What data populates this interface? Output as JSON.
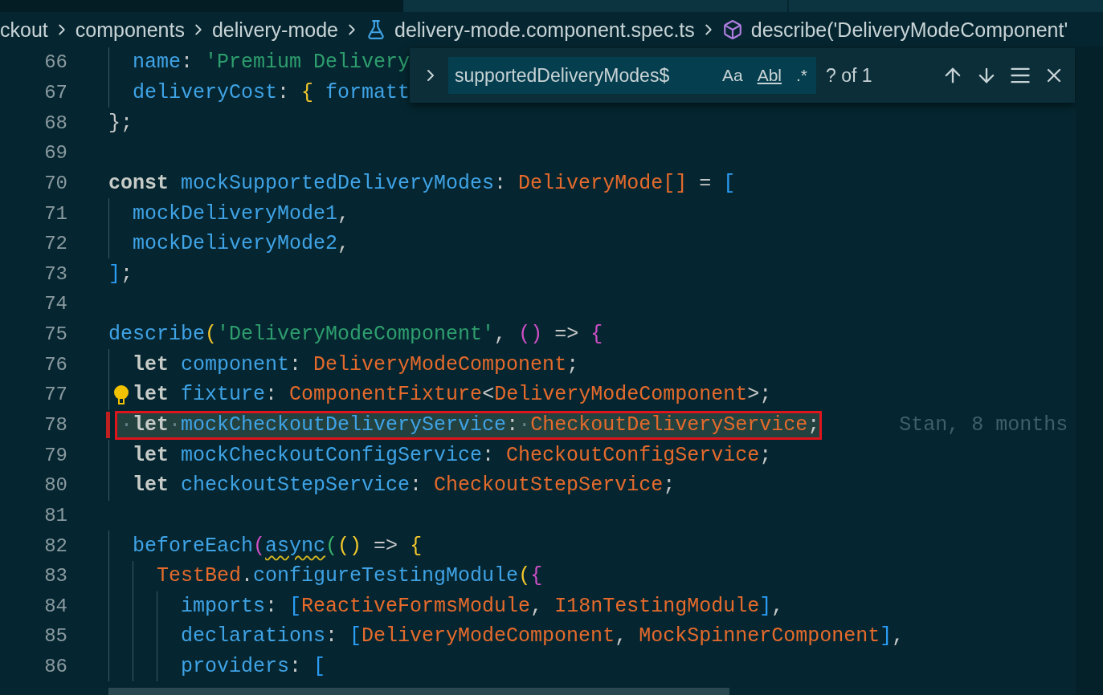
{
  "breadcrumbs": [
    {
      "kind": "folder",
      "label": "ckout"
    },
    {
      "kind": "folder",
      "label": "components"
    },
    {
      "kind": "folder",
      "label": "delivery-mode"
    },
    {
      "kind": "file",
      "label": "delivery-mode.component.spec.ts"
    },
    {
      "kind": "symbol",
      "label": "describe('DeliveryModeComponent'"
    }
  ],
  "find_widget": {
    "query": "supportedDeliveryModes$",
    "options": [
      {
        "label": "Aa",
        "on": false
      },
      {
        "label": "Abl",
        "on": false
      },
      {
        "label": ".*",
        "on": false
      }
    ],
    "result": "? of 1"
  },
  "lines": [
    {
      "number": "66",
      "tokens": [
        {
          "t": "  name",
          "kind": "prop"
        },
        {
          "t": ": ",
          "kind": "punct"
        },
        {
          "t": "'Premium Delivery",
          "kind": "str"
        }
      ]
    },
    {
      "number": "67",
      "tokens": [
        {
          "t": "  deliveryCost",
          "kind": "prop"
        },
        {
          "t": ": ",
          "kind": "punct"
        },
        {
          "t": "{ ",
          "kind": "b1"
        },
        {
          "t": "formatt",
          "kind": "prop"
        }
      ]
    },
    {
      "number": "68",
      "tokens": [
        {
          "t": "};",
          "kind": "punct"
        }
      ]
    },
    {
      "number": "69"
    },
    {
      "number": "70",
      "tokens": [
        {
          "t": "const ",
          "kind": "kw"
        },
        {
          "t": "mockSupportedDeliveryModes",
          "kind": "prop"
        },
        {
          "t": ": ",
          "kind": "punct"
        },
        {
          "t": "DeliveryMode[]",
          "kind": "type"
        },
        {
          "t": " = ",
          "kind": "punct"
        },
        {
          "t": "[",
          "kind": "b3"
        }
      ]
    },
    {
      "number": "71",
      "tokens": [
        {
          "t": "  mockDeliveryMode1",
          "kind": "prop"
        },
        {
          "t": ",",
          "kind": "punct"
        }
      ]
    },
    {
      "number": "72",
      "tokens": [
        {
          "t": "  mockDeliveryMode2",
          "kind": "prop"
        },
        {
          "t": ",",
          "kind": "punct"
        }
      ]
    },
    {
      "number": "73",
      "tokens": [
        {
          "t": "]",
          "kind": "b3"
        },
        {
          "t": ";",
          "kind": "punct"
        }
      ]
    },
    {
      "number": "74"
    },
    {
      "number": "75",
      "tokens": [
        {
          "t": "describe",
          "kind": "prop"
        },
        {
          "t": "(",
          "kind": "b1"
        },
        {
          "t": "'DeliveryModeComponent'",
          "kind": "str"
        },
        {
          "t": ", ",
          "kind": "punct"
        },
        {
          "t": "()",
          "kind": "b2"
        },
        {
          "t": " => ",
          "kind": "punct"
        },
        {
          "t": "{",
          "kind": "b2"
        }
      ]
    },
    {
      "number": "76",
      "tokens": [
        {
          "t": "  let ",
          "kind": "kw"
        },
        {
          "t": "component",
          "kind": "prop"
        },
        {
          "t": ": ",
          "kind": "punct"
        },
        {
          "t": "DeliveryModeComponent",
          "kind": "type"
        },
        {
          "t": ";",
          "kind": "punct"
        }
      ]
    },
    {
      "number": "77",
      "lightbulb": true,
      "tokens": [
        {
          "t": "  let ",
          "kind": "kw"
        },
        {
          "t": "fixture",
          "kind": "prop"
        },
        {
          "t": ": ",
          "kind": "punct"
        },
        {
          "t": "ComponentFixture",
          "kind": "type"
        },
        {
          "t": "<",
          "kind": "punct"
        },
        {
          "t": "DeliveryModeComponent",
          "kind": "type"
        },
        {
          "t": ">;",
          "kind": "punct"
        }
      ]
    },
    {
      "number": "78",
      "modified": true,
      "highlighted": true,
      "blame": "Stan, 8 months",
      "tokens": [
        {
          "t": "·",
          "kind": "dot"
        },
        {
          "t": "let",
          "kind": "kw"
        },
        {
          "t": "·",
          "kind": "dot"
        },
        {
          "t": "mockCheckoutDeliveryService",
          "kind": "prop"
        },
        {
          "t": ":",
          "kind": "punct"
        },
        {
          "t": "·",
          "kind": "dot"
        },
        {
          "t": "CheckoutDeliveryService",
          "kind": "type"
        },
        {
          "t": ";",
          "kind": "punct"
        }
      ]
    },
    {
      "number": "79",
      "tokens": [
        {
          "t": "  let ",
          "kind": "kw"
        },
        {
          "t": "mockCheckoutConfigService",
          "kind": "prop"
        },
        {
          "t": ": ",
          "kind": "punct"
        },
        {
          "t": "CheckoutConfigService",
          "kind": "type"
        },
        {
          "t": ";",
          "kind": "punct"
        }
      ]
    },
    {
      "number": "80",
      "tokens": [
        {
          "t": "  let ",
          "kind": "kw"
        },
        {
          "t": "checkoutStepService",
          "kind": "prop"
        },
        {
          "t": ": ",
          "kind": "punct"
        },
        {
          "t": "CheckoutStepService",
          "kind": "type"
        },
        {
          "t": ";",
          "kind": "punct"
        }
      ]
    },
    {
      "number": "81"
    },
    {
      "number": "82",
      "tokens": [
        {
          "t": "  beforeEach",
          "kind": "prop"
        },
        {
          "t": "(",
          "kind": "b2"
        },
        {
          "t": "async",
          "kind": "warn"
        },
        {
          "t": "(",
          "kind": "b4"
        },
        {
          "t": "()",
          "kind": "b1"
        },
        {
          "t": " => ",
          "kind": "punct"
        },
        {
          "t": "{",
          "kind": "b1"
        }
      ]
    },
    {
      "number": "83",
      "tokens": [
        {
          "t": "    TestBed",
          "kind": "type"
        },
        {
          "t": ".",
          "kind": "punct"
        },
        {
          "t": "configureTestingModule",
          "kind": "prop"
        },
        {
          "t": "(",
          "kind": "b1"
        },
        {
          "t": "{",
          "kind": "b2"
        }
      ]
    },
    {
      "number": "84",
      "tokens": [
        {
          "t": "      imports",
          "kind": "prop"
        },
        {
          "t": ": ",
          "kind": "punct"
        },
        {
          "t": "[",
          "kind": "b3"
        },
        {
          "t": "ReactiveFormsModule",
          "kind": "type"
        },
        {
          "t": ", ",
          "kind": "punct"
        },
        {
          "t": "I18nTestingModule",
          "kind": "type"
        },
        {
          "t": "]",
          "kind": "b3"
        },
        {
          "t": ",",
          "kind": "punct"
        }
      ]
    },
    {
      "number": "85",
      "tokens": [
        {
          "t": "      declarations",
          "kind": "prop"
        },
        {
          "t": ": ",
          "kind": "punct"
        },
        {
          "t": "[",
          "kind": "b3"
        },
        {
          "t": "DeliveryModeComponent",
          "kind": "type"
        },
        {
          "t": ", ",
          "kind": "punct"
        },
        {
          "t": "MockSpinnerComponent",
          "kind": "type"
        },
        {
          "t": "]",
          "kind": "b3"
        },
        {
          "t": ",",
          "kind": "punct"
        }
      ]
    },
    {
      "number": "86",
      "tokens": [
        {
          "t": "      providers",
          "kind": "prop"
        },
        {
          "t": ": ",
          "kind": "punct"
        },
        {
          "t": "[",
          "kind": "b3"
        }
      ]
    }
  ]
}
